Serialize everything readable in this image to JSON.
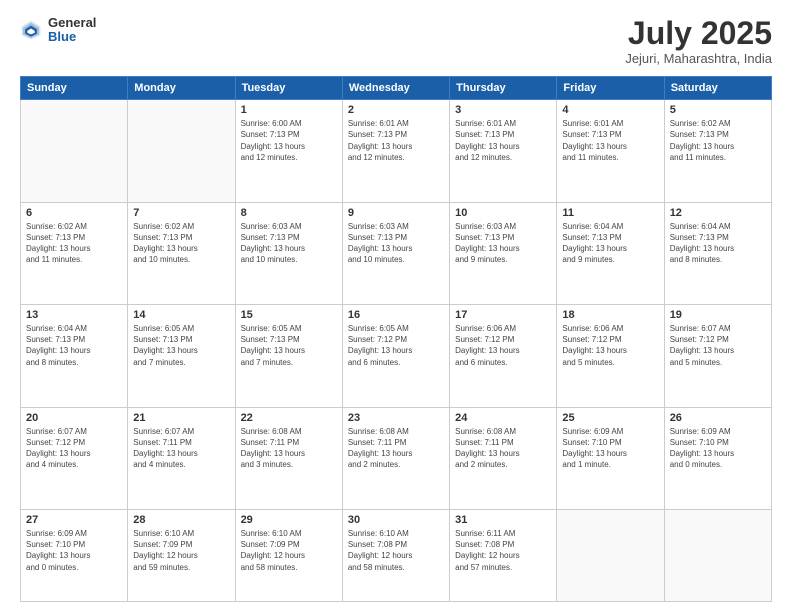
{
  "logo": {
    "general": "General",
    "blue": "Blue"
  },
  "title": "July 2025",
  "location": "Jejuri, Maharashtra, India",
  "weekdays": [
    "Sunday",
    "Monday",
    "Tuesday",
    "Wednesday",
    "Thursday",
    "Friday",
    "Saturday"
  ],
  "weeks": [
    [
      {
        "day": "",
        "detail": ""
      },
      {
        "day": "",
        "detail": ""
      },
      {
        "day": "1",
        "detail": "Sunrise: 6:00 AM\nSunset: 7:13 PM\nDaylight: 13 hours\nand 12 minutes."
      },
      {
        "day": "2",
        "detail": "Sunrise: 6:01 AM\nSunset: 7:13 PM\nDaylight: 13 hours\nand 12 minutes."
      },
      {
        "day": "3",
        "detail": "Sunrise: 6:01 AM\nSunset: 7:13 PM\nDaylight: 13 hours\nand 12 minutes."
      },
      {
        "day": "4",
        "detail": "Sunrise: 6:01 AM\nSunset: 7:13 PM\nDaylight: 13 hours\nand 11 minutes."
      },
      {
        "day": "5",
        "detail": "Sunrise: 6:02 AM\nSunset: 7:13 PM\nDaylight: 13 hours\nand 11 minutes."
      }
    ],
    [
      {
        "day": "6",
        "detail": "Sunrise: 6:02 AM\nSunset: 7:13 PM\nDaylight: 13 hours\nand 11 minutes."
      },
      {
        "day": "7",
        "detail": "Sunrise: 6:02 AM\nSunset: 7:13 PM\nDaylight: 13 hours\nand 10 minutes."
      },
      {
        "day": "8",
        "detail": "Sunrise: 6:03 AM\nSunset: 7:13 PM\nDaylight: 13 hours\nand 10 minutes."
      },
      {
        "day": "9",
        "detail": "Sunrise: 6:03 AM\nSunset: 7:13 PM\nDaylight: 13 hours\nand 10 minutes."
      },
      {
        "day": "10",
        "detail": "Sunrise: 6:03 AM\nSunset: 7:13 PM\nDaylight: 13 hours\nand 9 minutes."
      },
      {
        "day": "11",
        "detail": "Sunrise: 6:04 AM\nSunset: 7:13 PM\nDaylight: 13 hours\nand 9 minutes."
      },
      {
        "day": "12",
        "detail": "Sunrise: 6:04 AM\nSunset: 7:13 PM\nDaylight: 13 hours\nand 8 minutes."
      }
    ],
    [
      {
        "day": "13",
        "detail": "Sunrise: 6:04 AM\nSunset: 7:13 PM\nDaylight: 13 hours\nand 8 minutes."
      },
      {
        "day": "14",
        "detail": "Sunrise: 6:05 AM\nSunset: 7:13 PM\nDaylight: 13 hours\nand 7 minutes."
      },
      {
        "day": "15",
        "detail": "Sunrise: 6:05 AM\nSunset: 7:13 PM\nDaylight: 13 hours\nand 7 minutes."
      },
      {
        "day": "16",
        "detail": "Sunrise: 6:05 AM\nSunset: 7:12 PM\nDaylight: 13 hours\nand 6 minutes."
      },
      {
        "day": "17",
        "detail": "Sunrise: 6:06 AM\nSunset: 7:12 PM\nDaylight: 13 hours\nand 6 minutes."
      },
      {
        "day": "18",
        "detail": "Sunrise: 6:06 AM\nSunset: 7:12 PM\nDaylight: 13 hours\nand 5 minutes."
      },
      {
        "day": "19",
        "detail": "Sunrise: 6:07 AM\nSunset: 7:12 PM\nDaylight: 13 hours\nand 5 minutes."
      }
    ],
    [
      {
        "day": "20",
        "detail": "Sunrise: 6:07 AM\nSunset: 7:12 PM\nDaylight: 13 hours\nand 4 minutes."
      },
      {
        "day": "21",
        "detail": "Sunrise: 6:07 AM\nSunset: 7:11 PM\nDaylight: 13 hours\nand 4 minutes."
      },
      {
        "day": "22",
        "detail": "Sunrise: 6:08 AM\nSunset: 7:11 PM\nDaylight: 13 hours\nand 3 minutes."
      },
      {
        "day": "23",
        "detail": "Sunrise: 6:08 AM\nSunset: 7:11 PM\nDaylight: 13 hours\nand 2 minutes."
      },
      {
        "day": "24",
        "detail": "Sunrise: 6:08 AM\nSunset: 7:11 PM\nDaylight: 13 hours\nand 2 minutes."
      },
      {
        "day": "25",
        "detail": "Sunrise: 6:09 AM\nSunset: 7:10 PM\nDaylight: 13 hours\nand 1 minute."
      },
      {
        "day": "26",
        "detail": "Sunrise: 6:09 AM\nSunset: 7:10 PM\nDaylight: 13 hours\nand 0 minutes."
      }
    ],
    [
      {
        "day": "27",
        "detail": "Sunrise: 6:09 AM\nSunset: 7:10 PM\nDaylight: 13 hours\nand 0 minutes."
      },
      {
        "day": "28",
        "detail": "Sunrise: 6:10 AM\nSunset: 7:09 PM\nDaylight: 12 hours\nand 59 minutes."
      },
      {
        "day": "29",
        "detail": "Sunrise: 6:10 AM\nSunset: 7:09 PM\nDaylight: 12 hours\nand 58 minutes."
      },
      {
        "day": "30",
        "detail": "Sunrise: 6:10 AM\nSunset: 7:08 PM\nDaylight: 12 hours\nand 58 minutes."
      },
      {
        "day": "31",
        "detail": "Sunrise: 6:11 AM\nSunset: 7:08 PM\nDaylight: 12 hours\nand 57 minutes."
      },
      {
        "day": "",
        "detail": ""
      },
      {
        "day": "",
        "detail": ""
      }
    ]
  ]
}
